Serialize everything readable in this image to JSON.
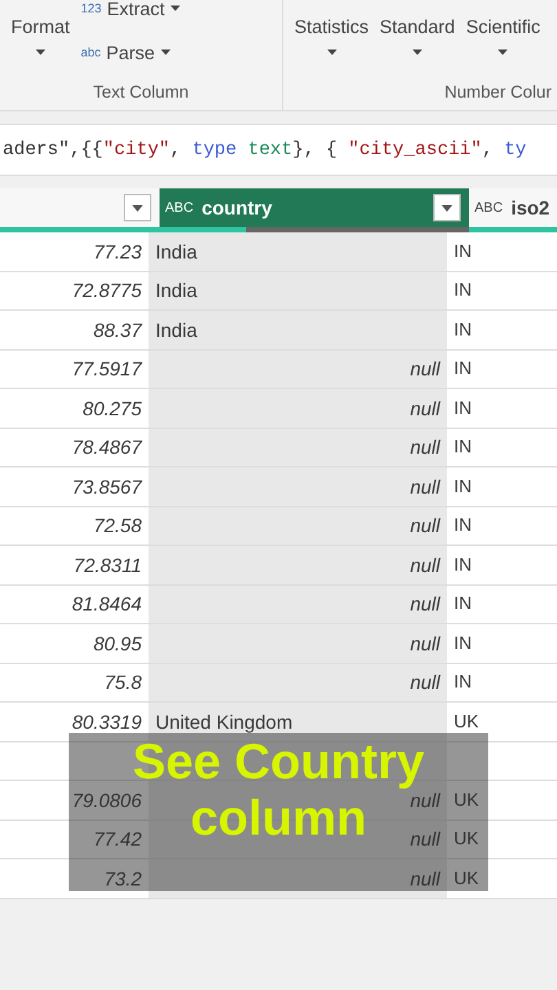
{
  "ribbon": {
    "text_group": {
      "label": "Text Column",
      "format": "Format",
      "extract": "Extract",
      "parse": "Parse",
      "extract_icon_text": "123",
      "parse_icon_text": "abc"
    },
    "number_group": {
      "label": "Number Colur",
      "buttons": [
        "Statistics",
        "Standard",
        "Scientific"
      ]
    }
  },
  "formula": [
    {
      "text": "aders\",{{",
      "kind": "plain"
    },
    {
      "text": "\"city\"",
      "kind": "string"
    },
    {
      "text": ",",
      "kind": "plain"
    },
    {
      "text": "type",
      "kind": "keyword"
    },
    {
      "text": "text",
      "kind": "type"
    },
    {
      "text": "},",
      "kind": "plain"
    },
    {
      "text": "{",
      "kind": "plain"
    },
    {
      "text": "\"city_ascii\"",
      "kind": "string"
    },
    {
      "text": ",",
      "kind": "plain"
    },
    {
      "text": "ty",
      "kind": "keyword"
    }
  ],
  "table": {
    "columns": [
      {
        "selected": false,
        "kind": "number"
      },
      {
        "title": "country",
        "selected": true,
        "kind": "text",
        "type_icon": "ABC",
        "quality": {
          "level": 0.28
        }
      },
      {
        "title": "iso2",
        "selected": false,
        "kind": "text",
        "type_icon": "ABC"
      }
    ],
    "rows": [
      {
        "lon": "77.23",
        "country": "India",
        "country_null": false,
        "iso2": "IN"
      },
      {
        "lon": "72.8775",
        "country": "India",
        "country_null": false,
        "iso2": "IN"
      },
      {
        "lon": "88.37",
        "country": "India",
        "country_null": false,
        "iso2": "IN"
      },
      {
        "lon": "77.5917",
        "country": "null",
        "country_null": true,
        "iso2": "IN"
      },
      {
        "lon": "80.275",
        "country": "null",
        "country_null": true,
        "iso2": "IN"
      },
      {
        "lon": "78.4867",
        "country": "null",
        "country_null": true,
        "iso2": "IN"
      },
      {
        "lon": "73.8567",
        "country": "null",
        "country_null": true,
        "iso2": "IN"
      },
      {
        "lon": "72.58",
        "country": "null",
        "country_null": true,
        "iso2": "IN"
      },
      {
        "lon": "72.8311",
        "country": "null",
        "country_null": true,
        "iso2": "IN"
      },
      {
        "lon": "81.8464",
        "country": "null",
        "country_null": true,
        "iso2": "IN"
      },
      {
        "lon": "80.95",
        "country": "null",
        "country_null": true,
        "iso2": "IN"
      },
      {
        "lon": "75.8",
        "country": "null",
        "country_null": true,
        "iso2": "IN"
      },
      {
        "lon": "80.3319",
        "country": "United Kingdom",
        "country_null": false,
        "iso2": "UK"
      },
      {},
      {
        "lon": "79.0806",
        "country": "null",
        "country_null": true,
        "iso2": "UK"
      },
      {
        "lon": "77.42",
        "country": "null",
        "country_null": true,
        "iso2": "UK"
      },
      {
        "lon": "73.2",
        "country": "null",
        "country_null": true,
        "iso2": "UK"
      }
    ]
  },
  "caption": {
    "lines": [
      "See Country",
      "column"
    ]
  }
}
